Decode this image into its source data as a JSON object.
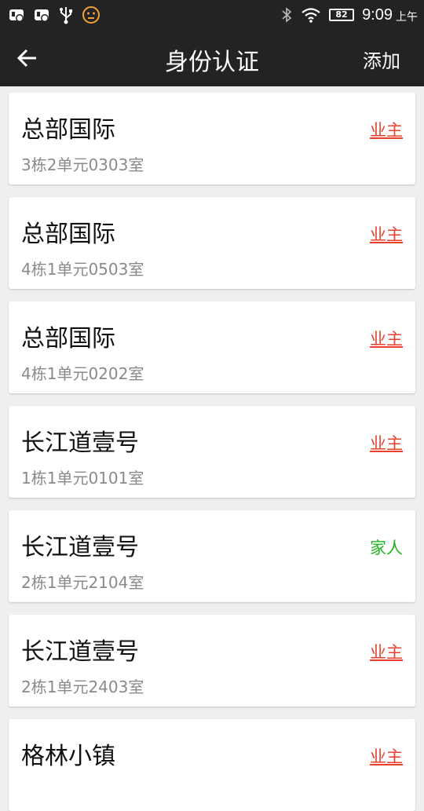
{
  "status_bar": {
    "battery": "82",
    "time": "9:09",
    "ampm": "上午"
  },
  "header": {
    "title": "身份认证",
    "add_label": "添加"
  },
  "colors": {
    "bar_bg": "#232323",
    "owner": "#e8402d",
    "family": "#1fb71f"
  },
  "cards": [
    {
      "title": "总部国际",
      "address": "3栋2单元0303室",
      "role": "业主",
      "role_type": "owner"
    },
    {
      "title": "总部国际",
      "address": "4栋1单元0503室",
      "role": "业主",
      "role_type": "owner"
    },
    {
      "title": "总部国际",
      "address": "4栋1单元0202室",
      "role": "业主",
      "role_type": "owner"
    },
    {
      "title": "长江道壹号",
      "address": "1栋1单元0101室",
      "role": "业主",
      "role_type": "owner"
    },
    {
      "title": "长江道壹号",
      "address": "2栋1单元2104室",
      "role": "家人",
      "role_type": "family"
    },
    {
      "title": "长江道壹号",
      "address": "2栋1单元2403室",
      "role": "业主",
      "role_type": "owner"
    },
    {
      "title": "格林小镇",
      "address": "",
      "role": "业主",
      "role_type": "owner"
    }
  ]
}
